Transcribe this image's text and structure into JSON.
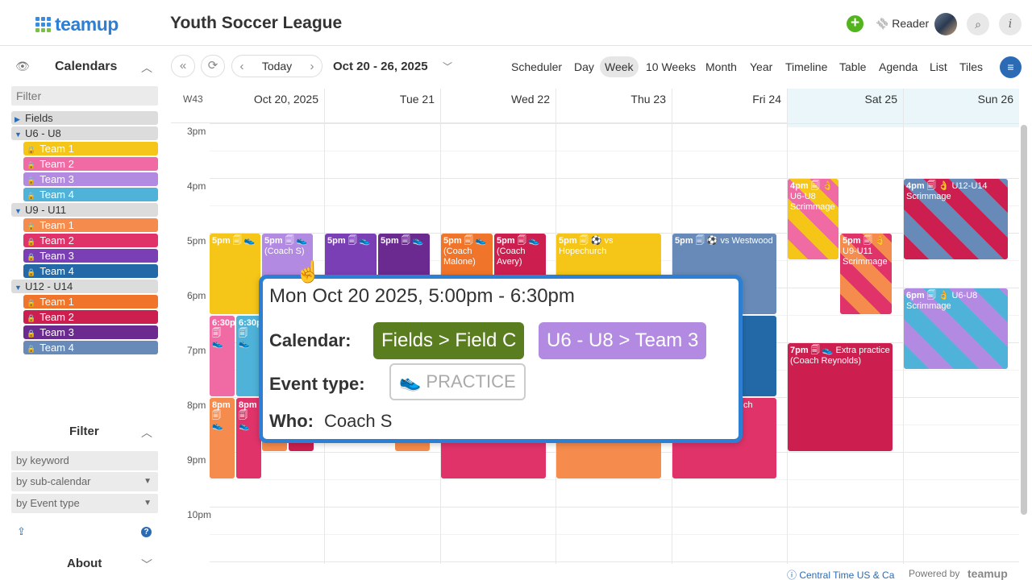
{
  "header": {
    "logo": "teamup",
    "title": "Youth Soccer League",
    "add": "+",
    "reader": "Reader",
    "link_icon": "⛓",
    "search_icon": "⌕",
    "info_icon": "i"
  },
  "sidebar": {
    "eye": "👁",
    "calendars_title": "Calendars",
    "chev_up": "︿",
    "filter_placeholder": "Filter",
    "fields": "Fields",
    "groups": [
      {
        "label": "U6 - U8",
        "teams": [
          "Team 1",
          "Team 2",
          "Team 3",
          "Team 4"
        ],
        "colors": [
          "#f5c518",
          "#f06ba3",
          "#b28ae2",
          "#4fb3d9"
        ]
      },
      {
        "label": "U9 - U11",
        "teams": [
          "Team 1",
          "Team 2",
          "Team 3",
          "Team 4"
        ],
        "colors": [
          "#f58b4c",
          "#e0336a",
          "#7a3fb4",
          "#2369a8"
        ]
      },
      {
        "label": "U12 - U14",
        "teams": [
          "Team 1",
          "Team 2",
          "Team 3",
          "Team 4"
        ],
        "colors": [
          "#f07429",
          "#cc1f4f",
          "#6a2a8f",
          "#678ab8"
        ]
      }
    ],
    "filter_title": "Filter",
    "filter_keyword": "by keyword",
    "filter_subcal": "by sub-calendar",
    "filter_type": "by Event type",
    "about": "About"
  },
  "toolbar": {
    "first": "«",
    "refresh": "⟳",
    "prev": "‹",
    "today": "Today",
    "next": "›",
    "date_range": "Oct 20 - 26, 2025",
    "views": [
      "Scheduler",
      "Day",
      "Week",
      "10 Weeks",
      "Month",
      "Year",
      "Timeline",
      "Table",
      "Agenda",
      "List",
      "Tiles"
    ],
    "active_view": "Week",
    "menu": "≡"
  },
  "grid": {
    "week": "W43",
    "days": [
      "Oct 20, 2025",
      "Tue 21",
      "Wed 22",
      "Thu 23",
      "Fri 24",
      "Sat 25",
      "Sun 26"
    ],
    "hours": [
      "3pm",
      "4pm",
      "5pm",
      "6pm",
      "7pm",
      "8pm",
      "9pm",
      "10pm"
    ]
  },
  "events": [
    {
      "time": "5pm",
      "title": "",
      "icons": "🗐 👟",
      "color": "#f5c518"
    },
    {
      "time": "5pm",
      "title": "(Coach S)",
      "icons": "🗐 👟",
      "color": "#b28ae2"
    },
    {
      "time": "6:30p",
      "title": "",
      "icons": "🗐 👟",
      "color": "#f06ba3"
    },
    {
      "time": "6:30p",
      "title": "",
      "icons": "🗐 👟",
      "color": "#4fb3d9"
    },
    {
      "time": "8pm",
      "title": "",
      "icons": "🗐 👟",
      "color": "#f58b4c"
    },
    {
      "time": "8pm",
      "title": "",
      "icons": "🗐 👟",
      "color": "#e0336a"
    },
    {
      "time": "5pm",
      "title": "",
      "icons": "🗐 👟",
      "color": "#7a3fb4"
    },
    {
      "time": "5pm",
      "title": "",
      "icons": "🗐 👟",
      "color": "#6a2a8f"
    },
    {
      "time": "5pm",
      "title": "(Coach Malone)",
      "icons": "🗐 👟",
      "color": "#f07429"
    },
    {
      "time": "5pm",
      "title": "(Coach Avery)",
      "icons": "🗐 👟",
      "color": "#cc1f4f"
    },
    {
      "time": "5pm",
      "title": "vs Hopechurch",
      "icons": "🗐 ⚽",
      "color": "#f5c518"
    },
    {
      "time": "5pm",
      "title": "vs Westwood",
      "icons": "🗐 ⚽",
      "color": "#678ab8"
    },
    {
      "time": "4pm",
      "title": "U6-U8 Scrimmage",
      "icons": "🗐 👌",
      "color": "#f5c518"
    },
    {
      "time": "5pm",
      "title": "U9-U11 Scrimmage",
      "icons": "🗐 👌",
      "color": "#e0336a"
    },
    {
      "time": "7pm",
      "title": "Extra practice (Coach Reynolds)",
      "icons": "🗐 👟",
      "color": "#cc1f4f"
    },
    {
      "time": "4pm",
      "title": "U12-U14 Scrimmage",
      "icons": "🗐 👌",
      "color": "#cc1f4f"
    },
    {
      "time": "6pm",
      "title": "U6-U8 Scrimmage",
      "icons": "🗐 👌",
      "color": "#4fb3d9"
    },
    {
      "time": "",
      "title": "",
      "icons": "",
      "color": "#f58b4c"
    },
    {
      "time": "",
      "title": "",
      "icons": "",
      "color": "#e0336a"
    },
    {
      "time": "",
      "title": "",
      "icons": "",
      "color": "#f58b4c"
    },
    {
      "time": "",
      "title": "",
      "icons": "",
      "color": "#cc1f4f"
    },
    {
      "time": "",
      "title": "",
      "icons": "",
      "color": "#2369a8"
    },
    {
      "time": "",
      "title": "ch",
      "icons": "",
      "color": "#e0336a"
    }
  ],
  "popup": {
    "when": "Mon Oct 20 2025, 5:00pm - 6:30pm",
    "calendar_label": "Calendar:",
    "calendar_chip1": "Fields > Field C",
    "calendar_chip2": "U6 - U8 > Team 3",
    "type_label": "Event type:",
    "type_value": "PRACTICE",
    "type_icon": "👟",
    "who_label": "Who:",
    "who_value": "Coach S"
  },
  "footer": {
    "timezone": "ⓘ Central Time US & Ca",
    "powered": "Powered by",
    "logo": "teamup"
  }
}
